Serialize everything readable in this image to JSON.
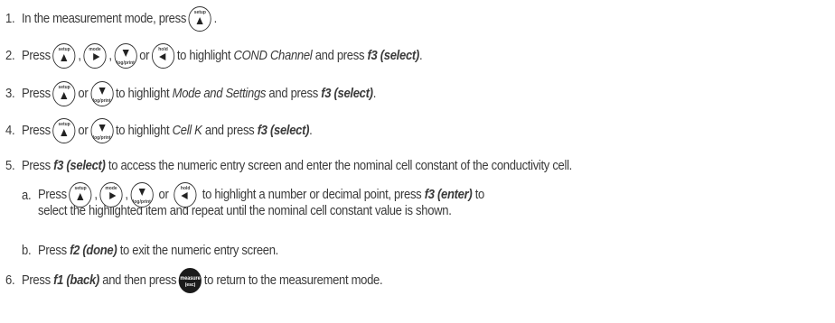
{
  "steps": [
    {
      "num": "1.",
      "text1": "In the measurement mode, press",
      "text2": "."
    },
    {
      "num": "2.",
      "press": "Press",
      "or": "or",
      "text1": "to highlight",
      "highlight": "COND Channel",
      "and_press": "and press",
      "action": "f3 (select)",
      "end": "."
    },
    {
      "num": "3.",
      "press": "Press",
      "or": "or",
      "text1": "to highlight",
      "highlight": "Mode and Settings",
      "and_press": "and press",
      "action": "f3 (select)",
      "end": "."
    },
    {
      "num": "4.",
      "press": "Press",
      "or": "or",
      "text1": "to highlight",
      "highlight": "Cell K",
      "and_press": "and press",
      "action": "f3 (select)",
      "end": "."
    },
    {
      "num": "5.",
      "press": "Press",
      "action": "f3 (select)",
      "text1": "to access the numeric entry screen and enter the nominal cell constant of the conductivity cell."
    },
    {
      "num": "a.",
      "press": "Press",
      "or": "or",
      "text1": "to highlight a number or decimal point, press",
      "action": "f3 (enter)",
      "text2": "to",
      "line2": "select the highlighted item and repeat until the nominal cell constant value is shown."
    },
    {
      "num": "b.",
      "press": "Press",
      "action": "f2 (done)",
      "text1": "to exit the numeric entry screen."
    },
    {
      "num": "6.",
      "press": "Press",
      "action": "f1 (back)",
      "text1": "and then press",
      "text2": "to return to the measurement mode."
    }
  ],
  "keys": {
    "setup": "setup",
    "mode": "mode",
    "log_print": "log/print",
    "hold": "hold",
    "measure": "measure",
    "esc": "(esc)"
  }
}
